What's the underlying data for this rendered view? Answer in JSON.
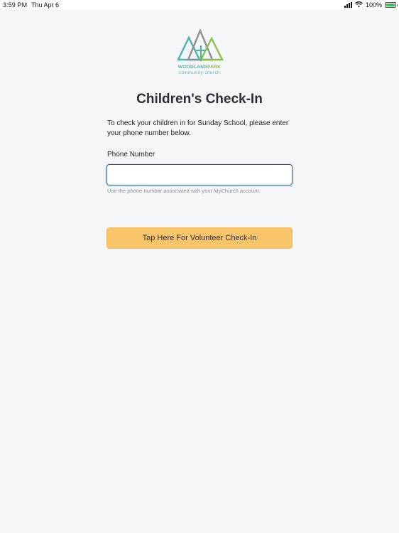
{
  "status_bar": {
    "time": "3:59 PM",
    "date": "Thu Apr 6",
    "battery": "100%",
    "icons": [
      "cellular-signal-icon",
      "wifi-icon",
      "battery-charging-icon"
    ]
  },
  "logo": {
    "word_part1": "WOODLAND",
    "word_part2": "PARK",
    "subtitle": "community church",
    "colors": {
      "gray": "#8a8f8f",
      "teal": "#4fb3a9",
      "green": "#8cc04a"
    }
  },
  "page": {
    "title": "Children's Check-In",
    "intro": "To check your children in for Sunday School, please enter your phone number below."
  },
  "form": {
    "phone_label": "Phone Number",
    "phone_value": "",
    "phone_placeholder": "",
    "phone_help": "Use the phone number associated with your MyChurch account."
  },
  "actions": {
    "volunteer_label": "Tap Here For Volunteer Check-In"
  },
  "colors": {
    "background": "#f5f6f8",
    "input_border": "#2c5d8a",
    "button_fill": "#f8c46a",
    "title_text": "#2d2f36",
    "help_text": "#8a9099"
  }
}
